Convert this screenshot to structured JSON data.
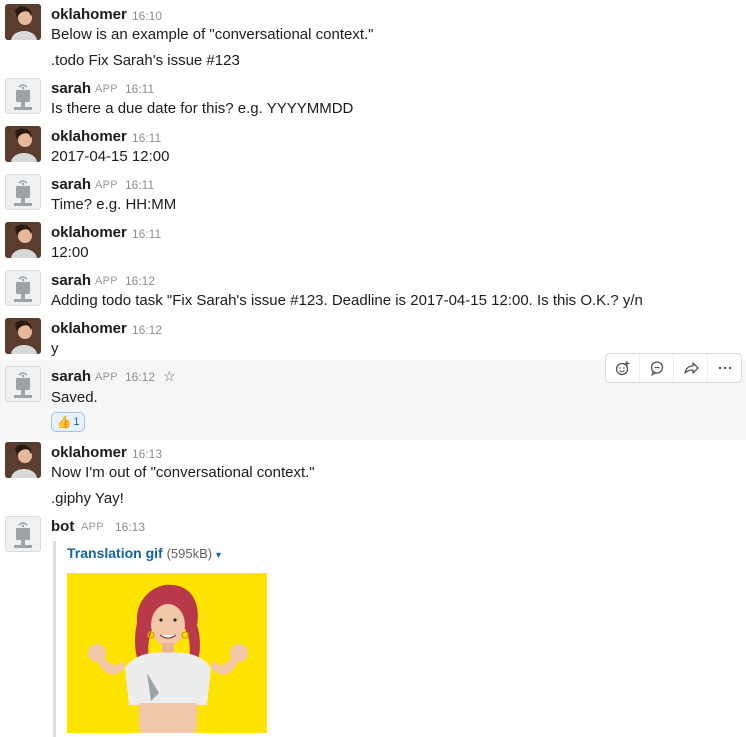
{
  "messages": [
    {
      "author": "oklahomer",
      "time": "16:10",
      "lines": [
        "Below is an example of \"conversational context.\"",
        ".todo Fix Sarah's issue #123"
      ]
    },
    {
      "author": "sarah",
      "app_tag": "APP",
      "time": "16:11",
      "lines": [
        "Is there a due date for this? e.g. YYYYMMDD"
      ]
    },
    {
      "author": "oklahomer",
      "time": "16:11",
      "lines": [
        "2017-04-15 12:00"
      ]
    },
    {
      "author": "sarah",
      "app_tag": "APP",
      "time": "16:11",
      "lines": [
        "Time? e.g. HH:MM"
      ]
    },
    {
      "author": "oklahomer",
      "time": "16:11",
      "lines": [
        "12:00"
      ]
    },
    {
      "author": "sarah",
      "app_tag": "APP",
      "time": "16:12",
      "lines": [
        "Adding todo task \"Fix Sarah's issue #123. Deadline is 2017-04-15 12:00. Is this O.K.? y/n"
      ]
    },
    {
      "author": "oklahomer",
      "time": "16:12",
      "lines": [
        "y"
      ]
    },
    {
      "author": "sarah",
      "app_tag": "APP",
      "time": "16:12",
      "lines": [
        "Saved."
      ],
      "star": "☆",
      "reaction": {
        "emoji": "👍",
        "count": "1"
      }
    },
    {
      "author": "oklahomer",
      "time": "16:13",
      "lines": [
        "Now I'm out of \"conversational context.\"",
        ".giphy Yay!"
      ]
    },
    {
      "author": "bot",
      "app_tag": "APP",
      "time": "16:13",
      "lines": []
    }
  ],
  "attachment": {
    "title": "Translation gif",
    "size": "(595kB)",
    "caret": "▾"
  },
  "toolbar": {
    "icons": [
      "add-reaction-icon",
      "comment-icon",
      "share-icon",
      "more-icon"
    ]
  },
  "colors": {
    "link": "#1264a3",
    "hover_bg": "#f6f6f6",
    "gif_bg": "#fde300"
  }
}
